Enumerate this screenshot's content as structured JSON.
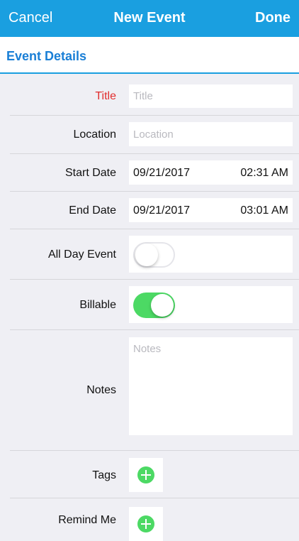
{
  "nav": {
    "cancel_label": "Cancel",
    "title": "New Event",
    "done_label": "Done"
  },
  "section": {
    "title": "Event Details"
  },
  "form": {
    "title": {
      "label": "Title",
      "placeholder": "Title",
      "required": true
    },
    "location": {
      "label": "Location",
      "placeholder": "Location"
    },
    "start_date": {
      "label": "Start Date",
      "date": "09/21/2017",
      "time": "02:31 AM"
    },
    "end_date": {
      "label": "End Date",
      "date": "09/21/2017",
      "time": "03:01 AM"
    },
    "all_day": {
      "label": "All Day Event",
      "value": false
    },
    "billable": {
      "label": "Billable",
      "value": true
    },
    "notes": {
      "label": "Notes",
      "placeholder": "Notes"
    },
    "tags": {
      "label": "Tags"
    },
    "remind_me": {
      "label": "Remind Me"
    }
  },
  "colors": {
    "nav_bar": "#1a9fe0",
    "section_title": "#1a7fd6",
    "required_label": "#e12d2d",
    "toggle_on": "#4cd964",
    "add_button": "#4cd964"
  }
}
